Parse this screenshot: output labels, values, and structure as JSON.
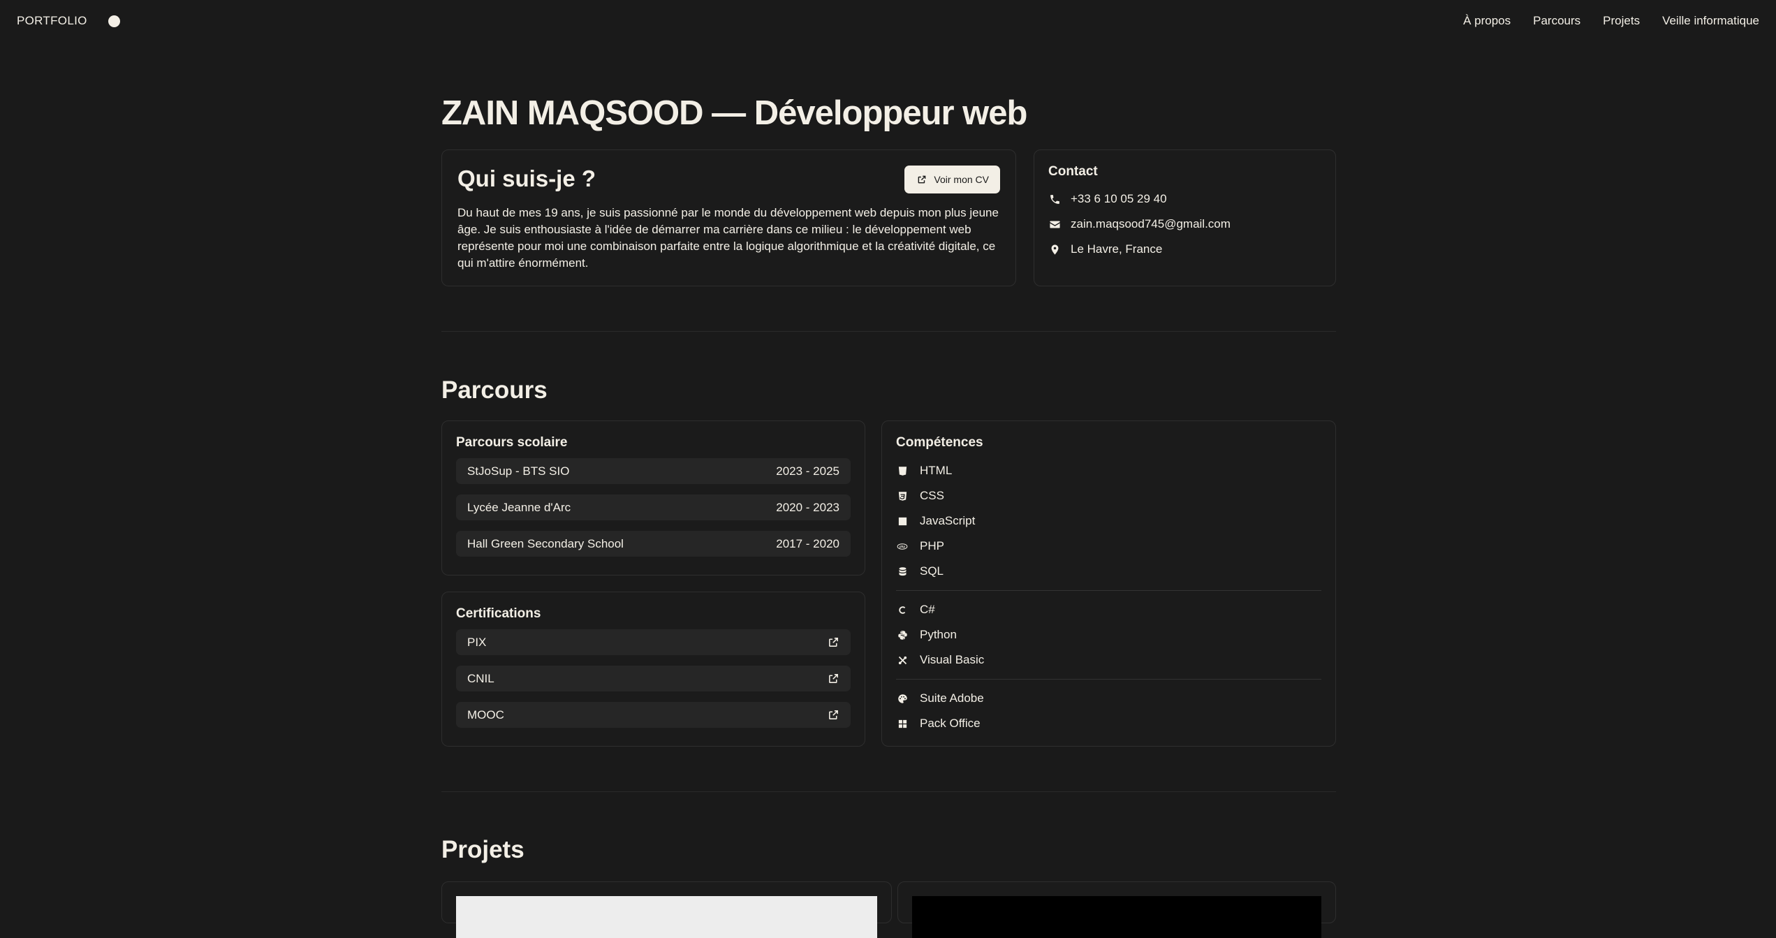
{
  "nav": {
    "brand": "PORTFOLIO",
    "links": [
      "À propos",
      "Parcours",
      "Projets",
      "Veille informatique"
    ]
  },
  "hero": {
    "title": "ZAIN MAQSOOD — Développeur web"
  },
  "about": {
    "title": "Qui suis-je ?",
    "cv_button": "Voir mon CV",
    "text": "Du haut de mes 19 ans, je suis passionné par le monde du développement web depuis mon plus jeune âge. Je suis enthousiaste à l'idée de démarrer ma carrière dans ce milieu : le développement web représente pour moi une combinaison parfaite entre la logique algorithmique et la créativité digitale, ce qui m'attire énormément."
  },
  "contact": {
    "title": "Contact",
    "phone": "+33 6 10 05 29 40",
    "email": "zain.maqsood745@gmail.com",
    "location": "Le Havre, France"
  },
  "parcours": {
    "title": "Parcours",
    "school_title": "Parcours scolaire",
    "school": [
      {
        "name": "StJoSup - BTS SIO",
        "years": "2023 - 2025"
      },
      {
        "name": "Lycée Jeanne d'Arc",
        "years": "2020 - 2023"
      },
      {
        "name": "Hall Green Secondary School",
        "years": "2017 - 2020"
      }
    ],
    "certs_title": "Certifications",
    "certs": [
      "PIX",
      "CNIL",
      "MOOC"
    ],
    "skills_title": "Compétences",
    "skills": [
      {
        "label": "HTML",
        "icon": "html5-icon"
      },
      {
        "label": "CSS",
        "icon": "css3-icon"
      },
      {
        "label": "JavaScript",
        "icon": "javascript-icon"
      },
      {
        "label": "PHP",
        "icon": "php-icon"
      },
      {
        "label": "SQL",
        "icon": "database-icon"
      },
      {
        "label": "C#",
        "icon": "csharp-icon"
      },
      {
        "label": "Python",
        "icon": "python-icon"
      },
      {
        "label": "Visual Basic",
        "icon": "tools-icon"
      },
      {
        "label": "Suite Adobe",
        "icon": "palette-icon"
      },
      {
        "label": "Pack Office",
        "icon": "grid-icon"
      }
    ]
  },
  "projets": {
    "title": "Projets"
  }
}
